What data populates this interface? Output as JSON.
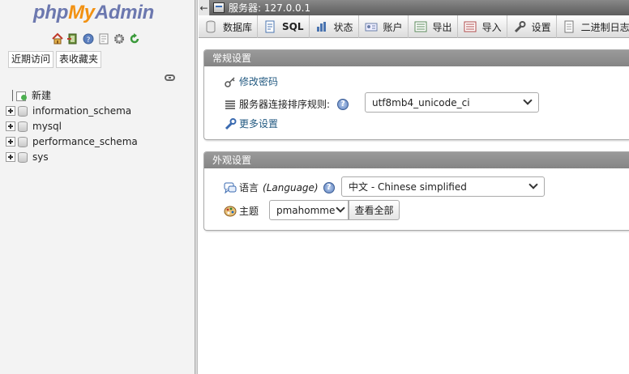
{
  "logo": {
    "php": "php",
    "my": "My",
    "admin": "Admin"
  },
  "nav": {
    "tabs": [
      "近期访问",
      "表收藏夹"
    ],
    "new_label": "新建",
    "databases": [
      "information_schema",
      "mysql",
      "performance_schema",
      "sys"
    ]
  },
  "server_bar": {
    "back": "←",
    "label": "服务器: 127.0.0.1"
  },
  "menu": [
    {
      "label": "数据库",
      "icon": "database-icon"
    },
    {
      "label": "SQL",
      "icon": "sql-icon"
    },
    {
      "label": "状态",
      "icon": "status-icon"
    },
    {
      "label": "账户",
      "icon": "accounts-icon"
    },
    {
      "label": "导出",
      "icon": "export-icon"
    },
    {
      "label": "导入",
      "icon": "import-icon"
    },
    {
      "label": "设置",
      "icon": "wrench-icon"
    },
    {
      "label": "二进制日志",
      "icon": "binlog-icon"
    }
  ],
  "general": {
    "title": "常规设置",
    "change_password": "修改密码",
    "collation_label": "服务器连接排序规则:",
    "collation_value": "utf8mb4_unicode_ci",
    "more_settings": "更多设置"
  },
  "appearance": {
    "title": "外观设置",
    "language_label": "语言",
    "language_en": "(Language)",
    "language_value": "中文 - Chinese simplified",
    "theme_label": "主题",
    "theme_value": "pmahomme",
    "view_all": "查看全部"
  },
  "colors": {
    "accent": "#6c78af",
    "brand_orange": "#f29111",
    "link": "#235a81"
  }
}
